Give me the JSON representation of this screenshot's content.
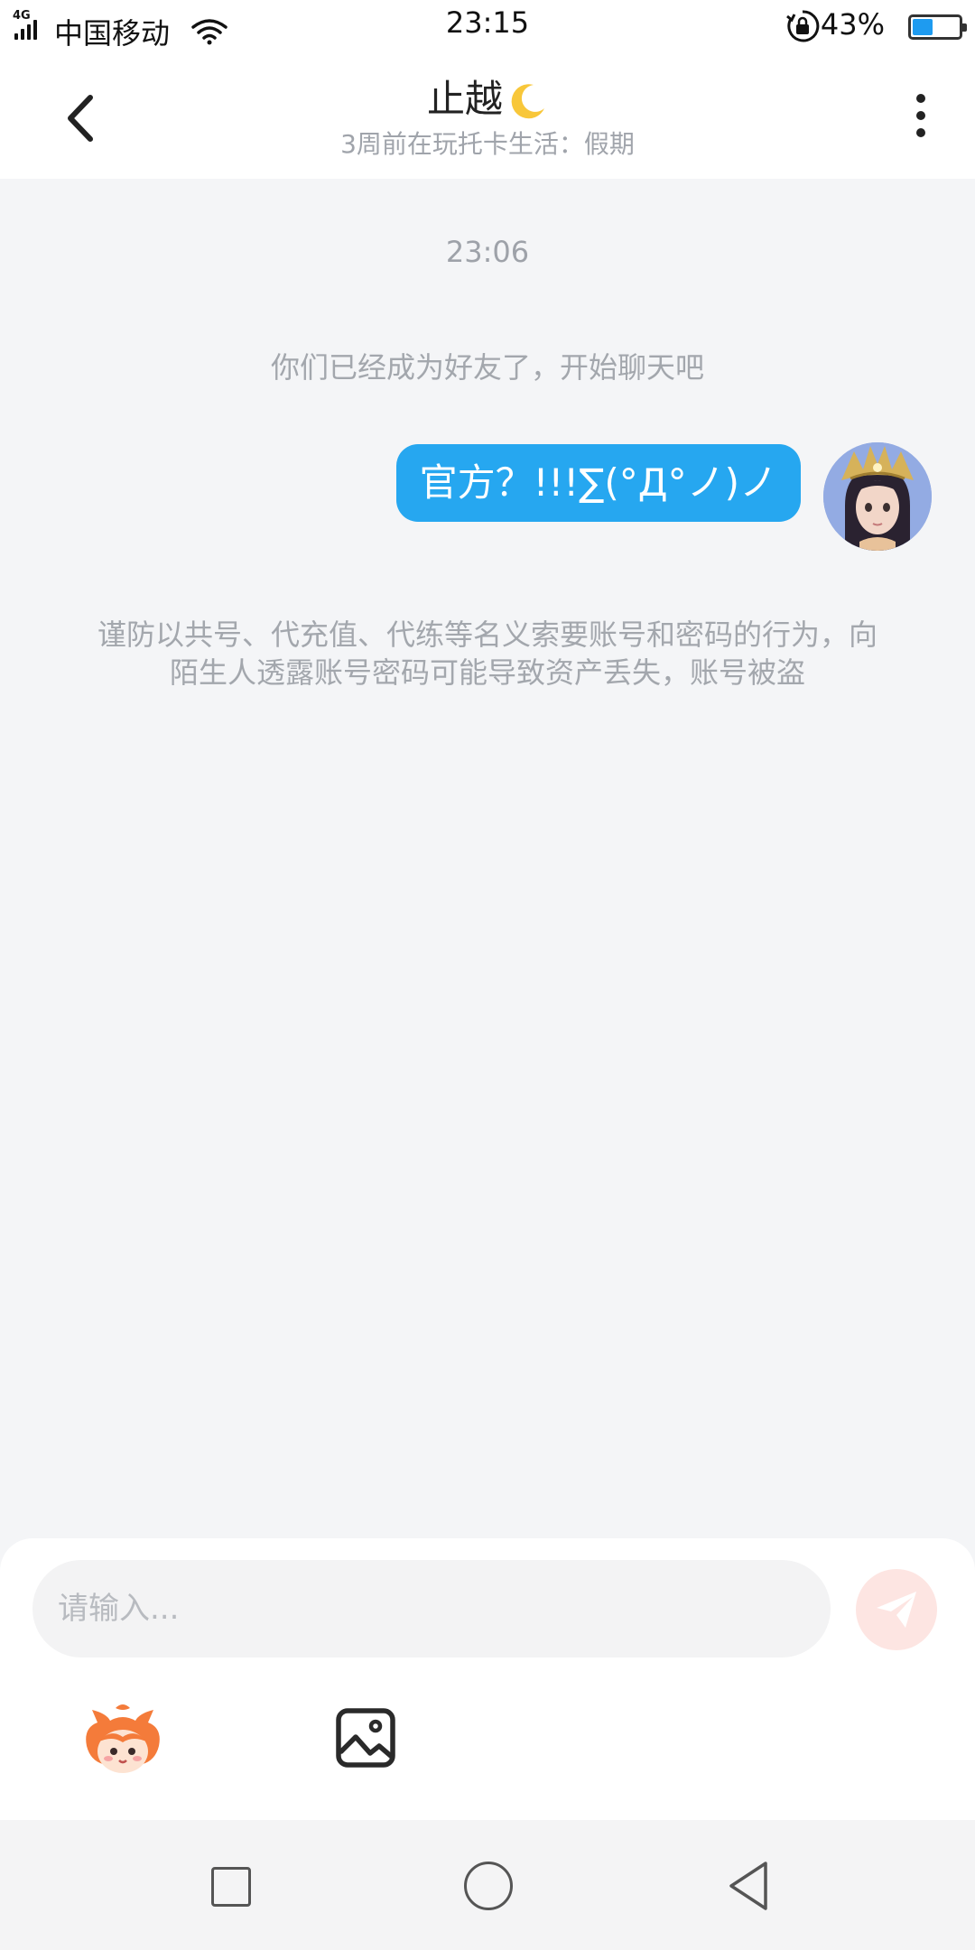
{
  "status_bar": {
    "network": "4G",
    "carrier": "中国移动",
    "time": "23:15",
    "battery_percent": "43%",
    "battery_level": 0.43,
    "icons": [
      "signal-icon",
      "wifi-icon",
      "rotation-lock-icon",
      "battery-icon"
    ]
  },
  "header": {
    "back_icon": "chevron-left-icon",
    "title": "止越",
    "title_emoji": "crescent-moon",
    "subtitle": "3周前在玩托卡生活：假期",
    "more_icon": "more-vertical-icon"
  },
  "chat": {
    "timestamp": "23:06",
    "system_message": "你们已经成为好友了，开始聊天吧",
    "messages": [
      {
        "side": "right",
        "text": "官方？!!!∑(°Д°ノ)ノ"
      }
    ],
    "warning": "谨防以共号、代充值、代练等名义索要账号和密码的行为，向陌生人透露账号密码可能导致资产丢失，账号被盗"
  },
  "input": {
    "placeholder": "请输入...",
    "send_icon": "paper-plane-icon",
    "emoji_icon": "mascot-emoji-icon",
    "image_icon": "image-icon"
  },
  "nav_bar": {
    "icons": [
      "recent-apps-icon",
      "home-icon",
      "back-icon"
    ]
  },
  "colors": {
    "accent": "#26a7f0",
    "background": "#f4f5f7",
    "send_disabled": "#fde5e2"
  }
}
